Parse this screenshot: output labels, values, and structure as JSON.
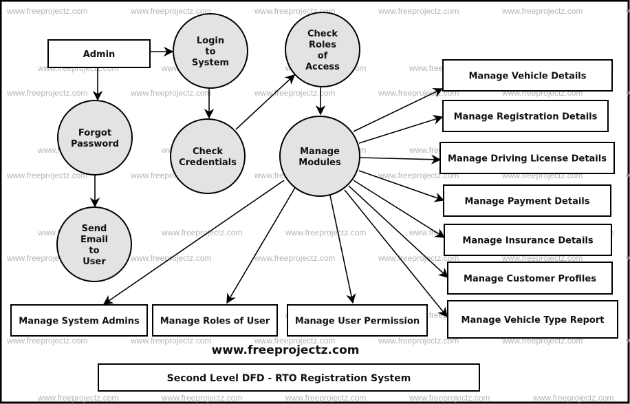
{
  "diagram": {
    "title": "Second Level DFD - RTO Registration System",
    "website": "www.freeprojectz.com",
    "watermark": "www.freeprojectz.com",
    "colors": {
      "process_fill": "#e3e3e3",
      "entity_fill": "#ffffff",
      "stroke": "#000000",
      "watermark": "#b4b4b4"
    },
    "entities": [
      {
        "id": "admin",
        "label": "Admin"
      },
      {
        "id": "vehicle",
        "label": "Manage Vehicle Details"
      },
      {
        "id": "registration",
        "label": "Manage Registration Details"
      },
      {
        "id": "license",
        "label": "Manage Driving License Details"
      },
      {
        "id": "payment",
        "label": "Manage Payment Details"
      },
      {
        "id": "insurance",
        "label": "Manage Insurance Details"
      },
      {
        "id": "customer",
        "label": "Manage Customer Profiles"
      },
      {
        "id": "vtype",
        "label": "Manage Vehicle Type Report"
      },
      {
        "id": "sysadmins",
        "label": "Manage System Admins"
      },
      {
        "id": "roles",
        "label": "Manage Roles of User"
      },
      {
        "id": "permission",
        "label": "Manage User Permission"
      }
    ],
    "processes": [
      {
        "id": "login",
        "lines": [
          "Login",
          "to",
          "System"
        ]
      },
      {
        "id": "checkroles",
        "lines": [
          "Check",
          "Roles",
          "of",
          "Access"
        ]
      },
      {
        "id": "forgot",
        "lines": [
          "Forgot",
          "Password"
        ]
      },
      {
        "id": "checkcred",
        "lines": [
          "Check",
          "Credentials"
        ]
      },
      {
        "id": "modules",
        "lines": [
          "Manage",
          "Modules"
        ]
      },
      {
        "id": "sendemail",
        "lines": [
          "Send",
          "Email",
          "to",
          "User"
        ]
      }
    ],
    "flows": [
      {
        "from": "admin",
        "to": "login"
      },
      {
        "from": "admin",
        "to": "forgot"
      },
      {
        "from": "forgot",
        "to": "sendemail"
      },
      {
        "from": "login",
        "to": "checkcred"
      },
      {
        "from": "checkcred",
        "to": "checkroles"
      },
      {
        "from": "checkroles",
        "to": "modules"
      },
      {
        "from": "modules",
        "to": "vehicle"
      },
      {
        "from": "modules",
        "to": "registration"
      },
      {
        "from": "modules",
        "to": "license"
      },
      {
        "from": "modules",
        "to": "payment"
      },
      {
        "from": "modules",
        "to": "insurance"
      },
      {
        "from": "modules",
        "to": "customer"
      },
      {
        "from": "modules",
        "to": "vtype"
      },
      {
        "from": "modules",
        "to": "sysadmins"
      },
      {
        "from": "modules",
        "to": "roles"
      },
      {
        "from": "modules",
        "to": "permission"
      }
    ]
  }
}
